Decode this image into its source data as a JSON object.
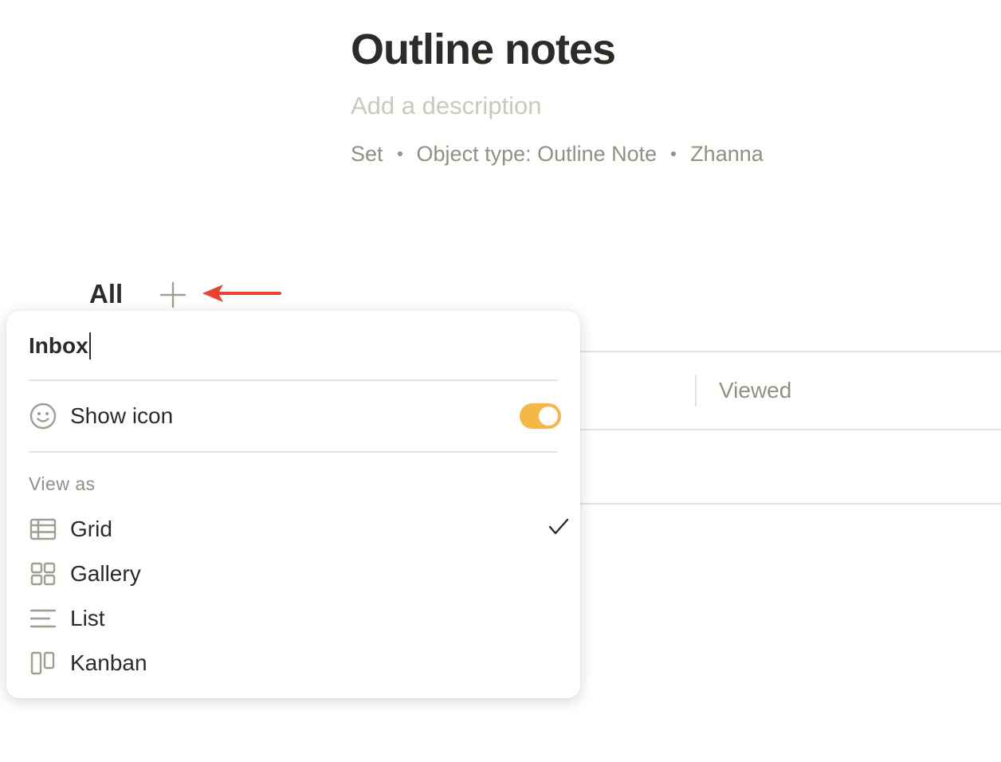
{
  "header": {
    "title": "Outline notes",
    "description_placeholder": "Add a description",
    "meta": [
      "Set",
      "Object type: Outline Note",
      "Zhanna"
    ]
  },
  "views": {
    "active_tab": "All",
    "add_icon": "plus-icon",
    "annotation": "red-arrow-icon"
  },
  "table": {
    "visible_column": "Viewed"
  },
  "view_menu": {
    "name_value": "Inbox",
    "show_icon": {
      "label": "Show icon",
      "icon": "smiley-icon",
      "enabled": true,
      "toggle_color": "#f5b748"
    },
    "view_as_label": "View as",
    "options": [
      {
        "label": "Grid",
        "icon": "grid-icon",
        "selected": true
      },
      {
        "label": "Gallery",
        "icon": "gallery-icon",
        "selected": false
      },
      {
        "label": "List",
        "icon": "list-icon",
        "selected": false
      },
      {
        "label": "Kanban",
        "icon": "kanban-icon",
        "selected": false
      }
    ]
  },
  "colors": {
    "text": "#2c2b27",
    "muted": "#929082",
    "placeholder": "#cbc9bd",
    "divider": "#e5e3d9",
    "accent": "#f5b748",
    "arrow": "#e8432e"
  }
}
